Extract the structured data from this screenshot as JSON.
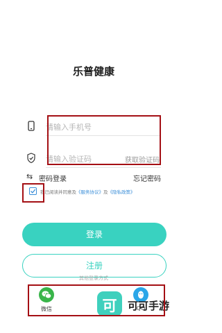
{
  "app": {
    "title": "乐普健康"
  },
  "form": {
    "phone_placeholder": "请输入手机号",
    "code_placeholder": "请输入验证码",
    "get_code_label": "获取验证码"
  },
  "links": {
    "swap_glyph": "⇆",
    "password_login": "密码登录",
    "forgot_password": "忘记密码"
  },
  "agreement": {
    "checked": true,
    "prefix": "我已阅读并同意及",
    "service_link": "《服务协议》",
    "joiner": "及",
    "privacy_link": "《隐私政策》"
  },
  "buttons": {
    "login": "登录",
    "register": "注册"
  },
  "other_login": {
    "label": "其他登录方式",
    "wechat_label": "微信",
    "qq_label": "QQ"
  },
  "watermark": {
    "glyph": "可",
    "text": "可可手游"
  },
  "colors": {
    "accent": "#39d2c0",
    "link": "#3a8ed8",
    "highlight": "#a40f14",
    "wechat": "#39b54a",
    "qq": "#2aa6e8"
  }
}
